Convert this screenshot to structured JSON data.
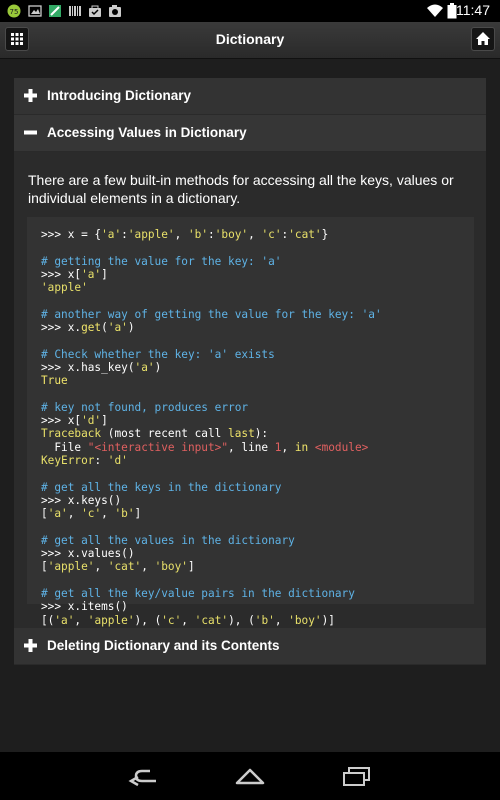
{
  "status_bar": {
    "time": "11:47"
  },
  "action_bar": {
    "title": "Dictionary",
    "menu_icon": "grid-icon",
    "home_icon": "home-icon"
  },
  "sections": [
    {
      "title": "Introducing Dictionary",
      "expanded": false
    },
    {
      "title": "Accessing Values in Dictionary",
      "expanded": true
    },
    {
      "title": "Deleting Dictionary and its Contents",
      "expanded": false
    }
  ],
  "description": "There are a few built-in methods for accessing all the keys, values or individual elements in a dictionary.",
  "code_lines": [
    ">>> x = {'a':'apple', 'b':'boy', 'c':'cat'}",
    "",
    "# getting the value for the key: 'a'",
    ">>> x['a']",
    "'apple'",
    "",
    "# another way of getting the value for the key: 'a'",
    ">>> x.get('a')",
    "",
    "# Check whether the key: 'a' exists",
    ">>> x.has_key('a')",
    "True",
    "",
    "# key not found, produces error",
    ">>> x['d']",
    "Traceback (most recent call last):",
    "  File \"<interactive input>\", line 1, in <module>",
    "KeyError: 'd'",
    "",
    "# get all the keys in the dictionary",
    ">>> x.keys()",
    "['a', 'c', 'b']",
    "",
    "# get all the values in the dictionary",
    ">>> x.values()",
    "['apple', 'cat', 'boy']",
    "",
    "# get all the key/value pairs in the dictionary",
    ">>> x.items()",
    "[('a', 'apple'), ('c', 'cat'), ('b', 'boy')]"
  ],
  "colors": {
    "comment": "#5fb3e6",
    "string": "#e8e06a",
    "keyword": "#f0e46a",
    "code_bg": "#333333"
  },
  "nav_icons": [
    "back-icon",
    "home-icon",
    "recent-apps-icon"
  ]
}
